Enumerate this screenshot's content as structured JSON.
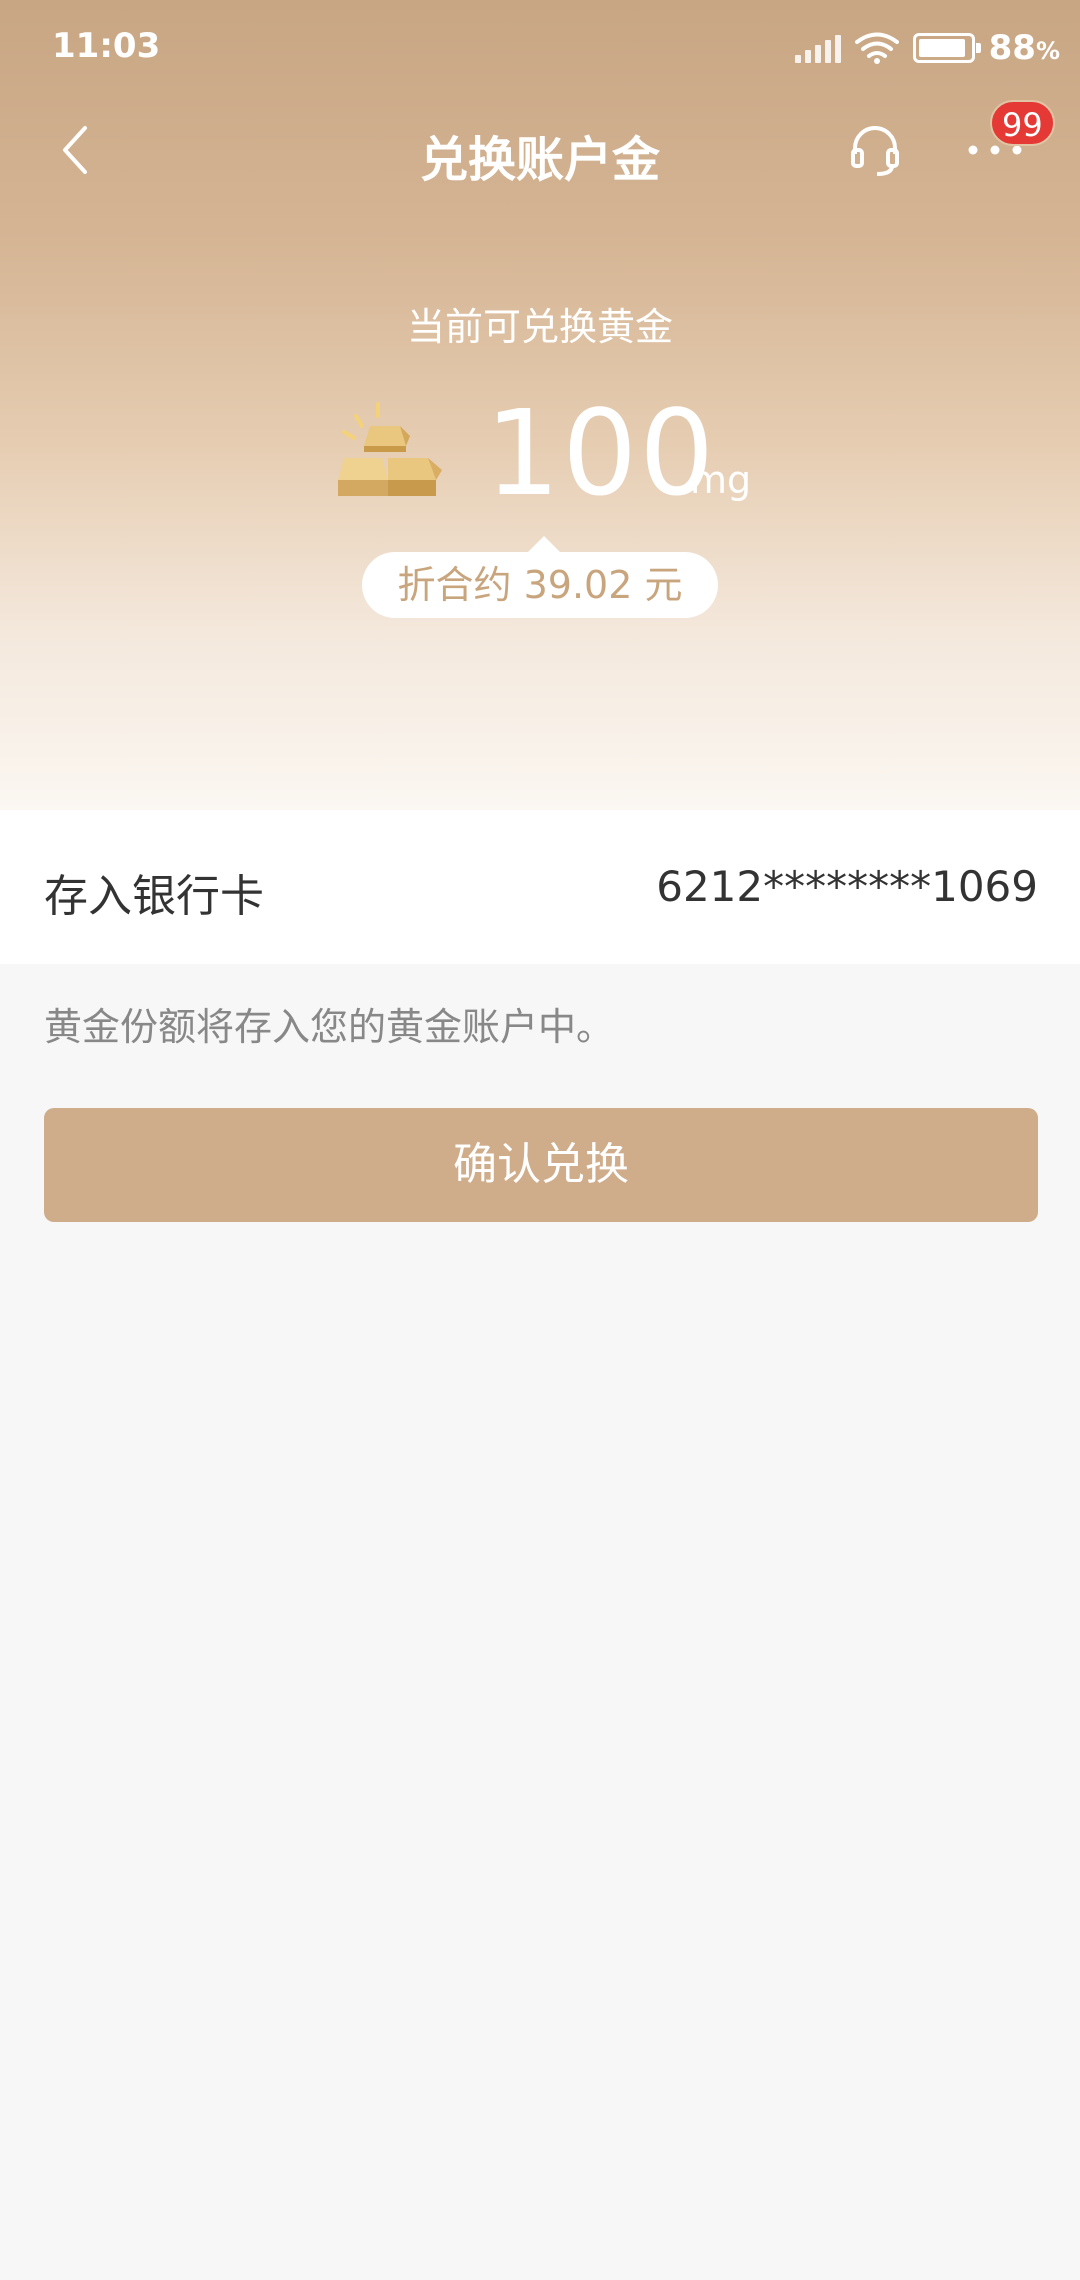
{
  "status_bar": {
    "time": "11:03",
    "battery_percent": "88",
    "battery_unit": "%",
    "signal_icon": "signal-icon",
    "wifi_icon": "wifi-icon",
    "battery_icon": "battery-icon"
  },
  "nav": {
    "title": "兑换账户金",
    "back_icon": "chevron-left-icon",
    "service_icon": "headset-icon",
    "more_icon": "more-dots-icon",
    "badge_count": "99"
  },
  "summary": {
    "label": "当前可兑换黄金",
    "amount": "100",
    "unit": "mg",
    "equivalent": "折合约 39.02 元",
    "gold_icon": "gold-bars-icon"
  },
  "deposit": {
    "label": "存入银行卡",
    "card_number": "6212********1069"
  },
  "hint": "黄金份额将存入您的黄金账户中。",
  "confirm_label": "确认兑换",
  "colors": {
    "header_top": "#c8a684",
    "accent_button": "#cfac8a",
    "badge": "#e53935",
    "pill_text": "#c9a57e"
  }
}
